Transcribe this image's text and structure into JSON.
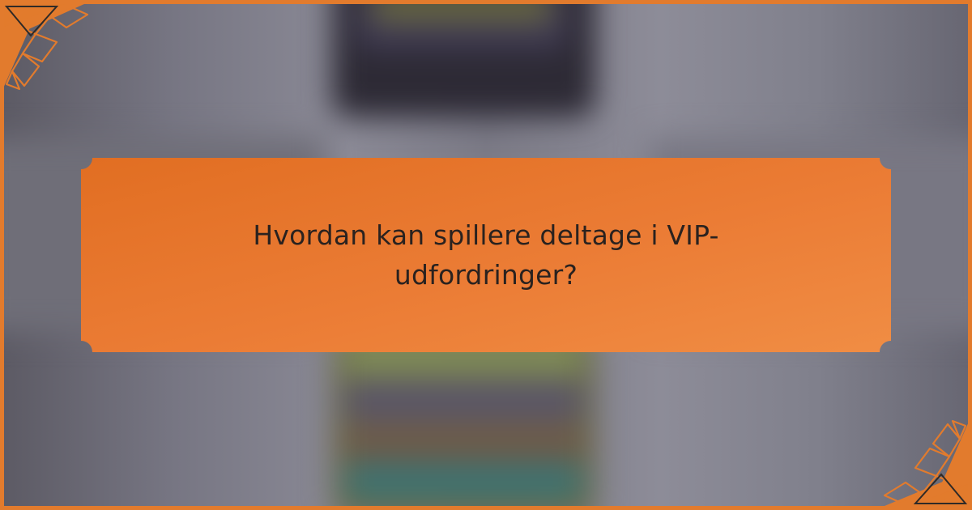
{
  "hero": {
    "title": "Hvordan kan spillere deltage i VIP-udfordringer?"
  },
  "colors": {
    "banner_orange": "#e8742c",
    "banner_orange_light": "#f08a42",
    "title_text": "#2a221f",
    "frame_orange": "#e27b2d"
  },
  "icons": {
    "top_left_corner": "corner-ornament-icon",
    "bottom_right_corner": "corner-ornament-icon"
  }
}
